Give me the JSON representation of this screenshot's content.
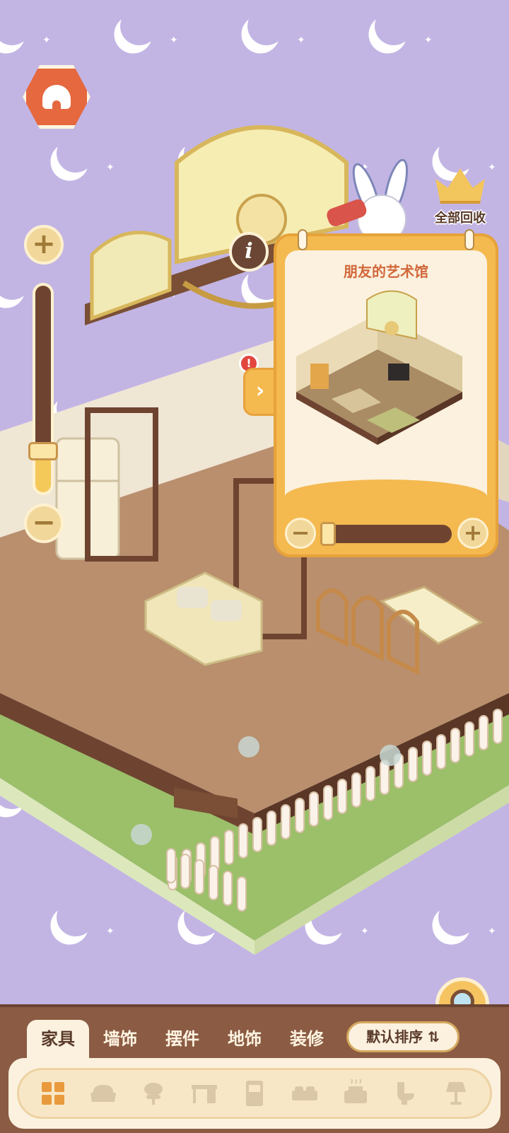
{
  "hud": {
    "recycle_label": "全部回收",
    "zoom_level_fraction": 0.24
  },
  "friend_panel": {
    "title": "朋友的艺术馆",
    "alert": "!",
    "expand": "›",
    "zoom_level_fraction": 0.03
  },
  "tabs": [
    {
      "label": "家具",
      "active": true
    },
    {
      "label": "墙饰",
      "active": false
    },
    {
      "label": "摆件",
      "active": false
    },
    {
      "label": "地饰",
      "active": false
    },
    {
      "label": "装修",
      "active": false
    }
  ],
  "sort": {
    "label": "默认排序 ⇅"
  },
  "categories": [
    "all-icon",
    "armchair-icon",
    "chair-icon",
    "desk-icon",
    "cabinet-icon",
    "bed-icon",
    "stove-icon",
    "toilet-icon",
    "lamp-icon"
  ],
  "colors": {
    "background": "#c2b5e4",
    "accent": "#f4b94f",
    "bar": "#8b5b43",
    "home": "#e5683f"
  }
}
